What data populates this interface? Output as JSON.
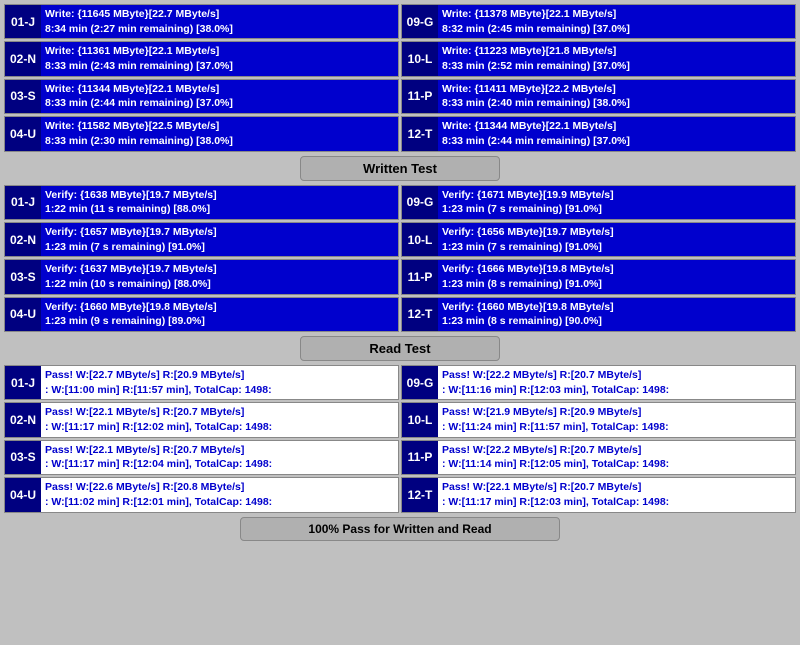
{
  "write_section": {
    "devices_left": [
      {
        "label": "01-J",
        "line1": "Write: {11645 MByte}[22.7 MByte/s]",
        "line2": "8:34 min (2:27 min remaining)  [38.0%]"
      },
      {
        "label": "02-N",
        "line1": "Write: {11361 MByte}[22.1 MByte/s]",
        "line2": "8:33 min (2:43 min remaining)  [37.0%]"
      },
      {
        "label": "03-S",
        "line1": "Write: {11344 MByte}[22.1 MByte/s]",
        "line2": "8:33 min (2:44 min remaining)  [37.0%]"
      },
      {
        "label": "04-U",
        "line1": "Write: {11582 MByte}[22.5 MByte/s]",
        "line2": "8:33 min (2:30 min remaining)  [38.0%]"
      }
    ],
    "devices_right": [
      {
        "label": "09-G",
        "line1": "Write: {11378 MByte}[22.1 MByte/s]",
        "line2": "8:32 min (2:45 min remaining)  [37.0%]"
      },
      {
        "label": "10-L",
        "line1": "Write: {11223 MByte}[21.8 MByte/s]",
        "line2": "8:33 min (2:52 min remaining)  [37.0%]"
      },
      {
        "label": "11-P",
        "line1": "Write: {11411 MByte}[22.2 MByte/s]",
        "line2": "8:33 min (2:40 min remaining)  [38.0%]"
      },
      {
        "label": "12-T",
        "line1": "Write: {11344 MByte}[22.1 MByte/s]",
        "line2": "8:33 min (2:44 min remaining)  [37.0%]"
      }
    ],
    "header": "Written Test"
  },
  "verify_section": {
    "devices_left": [
      {
        "label": "01-J",
        "line1": "Verify: {1638 MByte}[19.7 MByte/s]",
        "line2": "1:22 min (11 s remaining)   [88.0%]"
      },
      {
        "label": "02-N",
        "line1": "Verify: {1657 MByte}[19.7 MByte/s]",
        "line2": "1:23 min (7 s remaining)   [91.0%]"
      },
      {
        "label": "03-S",
        "line1": "Verify: {1637 MByte}[19.7 MByte/s]",
        "line2": "1:22 min (10 s remaining)   [88.0%]"
      },
      {
        "label": "04-U",
        "line1": "Verify: {1660 MByte}[19.8 MByte/s]",
        "line2": "1:23 min (9 s remaining)   [89.0%]"
      }
    ],
    "devices_right": [
      {
        "label": "09-G",
        "line1": "Verify: {1671 MByte}[19.9 MByte/s]",
        "line2": "1:23 min (7 s remaining)   [91.0%]"
      },
      {
        "label": "10-L",
        "line1": "Verify: {1656 MByte}[19.7 MByte/s]",
        "line2": "1:23 min (7 s remaining)   [91.0%]"
      },
      {
        "label": "11-P",
        "line1": "Verify: {1666 MByte}[19.8 MByte/s]",
        "line2": "1:23 min (8 s remaining)   [91.0%]"
      },
      {
        "label": "12-T",
        "line1": "Verify: {1660 MByte}[19.8 MByte/s]",
        "line2": "1:23 min (8 s remaining)   [90.0%]"
      }
    ],
    "header": "Read Test"
  },
  "pass_section": {
    "devices_left": [
      {
        "label": "01-J",
        "line1": "Pass! W:[22.7 MByte/s] R:[20.9 MByte/s]",
        "line2": ": W:[11:00 min] R:[11:57 min], TotalCap: 1498:"
      },
      {
        "label": "02-N",
        "line1": "Pass! W:[22.1 MByte/s] R:[20.7 MByte/s]",
        "line2": ": W:[11:17 min] R:[12:02 min], TotalCap: 1498:"
      },
      {
        "label": "03-S",
        "line1": "Pass! W:[22.1 MByte/s] R:[20.7 MByte/s]",
        "line2": ": W:[11:17 min] R:[12:04 min], TotalCap: 1498:"
      },
      {
        "label": "04-U",
        "line1": "Pass! W:[22.6 MByte/s] R:[20.8 MByte/s]",
        "line2": ": W:[11:02 min] R:[12:01 min], TotalCap: 1498:"
      }
    ],
    "devices_right": [
      {
        "label": "09-G",
        "line1": "Pass! W:[22.2 MByte/s] R:[20.7 MByte/s]",
        "line2": ": W:[11:16 min] R:[12:03 min], TotalCap: 1498:"
      },
      {
        "label": "10-L",
        "line1": "Pass! W:[21.9 MByte/s] R:[20.9 MByte/s]",
        "line2": ": W:[11:24 min] R:[11:57 min], TotalCap: 1498:"
      },
      {
        "label": "11-P",
        "line1": "Pass! W:[22.2 MByte/s] R:[20.7 MByte/s]",
        "line2": ": W:[11:14 min] R:[12:05 min], TotalCap: 1498:"
      },
      {
        "label": "12-T",
        "line1": "Pass! W:[22.1 MByte/s] R:[20.7 MByte/s]",
        "line2": ": W:[11:17 min] R:[12:03 min], TotalCap: 1498:"
      }
    ]
  },
  "footer": "100% Pass for Written and Read"
}
